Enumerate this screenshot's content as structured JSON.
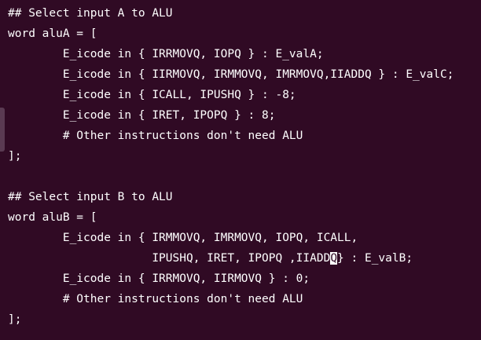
{
  "editor": {
    "lines": [
      {
        "pre": "## Select input A to ALU",
        "cursor": "",
        "post": ""
      },
      {
        "pre": "word aluA = [",
        "cursor": "",
        "post": ""
      },
      {
        "pre": "        E_icode in { IRRMOVQ, IOPQ } : E_valA;",
        "cursor": "",
        "post": ""
      },
      {
        "pre": "        E_icode in { IIRMOVQ, IRMMOVQ, IMRMOVQ,IIADDQ } : E_valC;",
        "cursor": "",
        "post": ""
      },
      {
        "pre": "        E_icode in { ICALL, IPUSHQ } : -8;",
        "cursor": "",
        "post": ""
      },
      {
        "pre": "        E_icode in { IRET, IPOPQ } : 8;",
        "cursor": "",
        "post": ""
      },
      {
        "pre": "        # Other instructions don't need ALU",
        "cursor": "",
        "post": ""
      },
      {
        "pre": "];",
        "cursor": "",
        "post": ""
      },
      {
        "pre": "",
        "cursor": "",
        "post": ""
      },
      {
        "pre": "## Select input B to ALU",
        "cursor": "",
        "post": ""
      },
      {
        "pre": "word aluB = [",
        "cursor": "",
        "post": ""
      },
      {
        "pre": "        E_icode in { IRMMOVQ, IMRMOVQ, IOPQ, ICALL,",
        "cursor": "",
        "post": ""
      },
      {
        "pre": "                     IPUSHQ, IRET, IPOPQ ,IIADD",
        "cursor": "Q",
        "post": "} : E_valB;"
      },
      {
        "pre": "        E_icode in { IRRMOVQ, IIRMOVQ } : 0;",
        "cursor": "",
        "post": ""
      },
      {
        "pre": "        # Other instructions don't need ALU",
        "cursor": "",
        "post": ""
      },
      {
        "pre": "];",
        "cursor": "",
        "post": ""
      }
    ]
  }
}
